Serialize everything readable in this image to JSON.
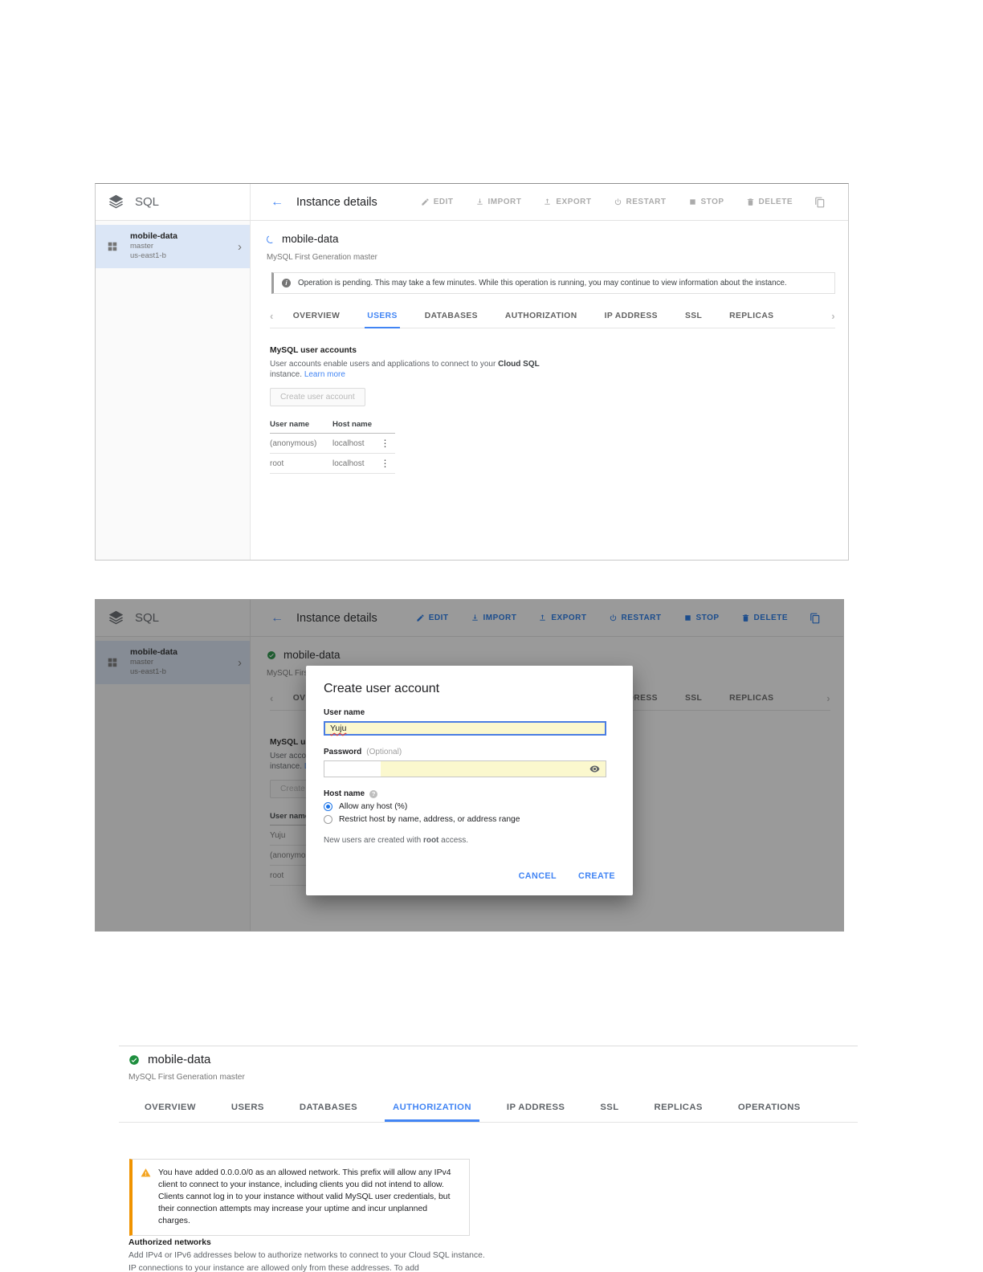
{
  "colors": {
    "accent_blue": "#4285f4",
    "toolbar_action_blue": "#1a73e8",
    "status_green": "#1e8e3e",
    "warning_orange": "#f09300",
    "autofill_yellow": "#fbf8ce",
    "selected_row_blue": "#dbe6f6"
  },
  "icons": {
    "back": "←",
    "overflow_menu": "⋮",
    "sidebar_chevron": "›",
    "tabs_prev": "‹",
    "tabs_next": "›",
    "info": "i",
    "help": "?"
  },
  "appbar": {
    "product": "SQL",
    "title": "Instance details",
    "actions": [
      "EDIT",
      "IMPORT",
      "EXPORT",
      "RESTART",
      "STOP",
      "DELETE"
    ]
  },
  "sidebar": {
    "instance_name": "mobile-data",
    "instance_role": "master",
    "instance_zone": "us-east1-b"
  },
  "instance": {
    "name": "mobile-data",
    "subtitle": "MySQL First Generation master"
  },
  "banner": {
    "text": "Operation is pending. This may take a few minutes. While this operation is running, you may continue to view information about the instance."
  },
  "tabs_main": [
    "OVERVIEW",
    "USERS",
    "DATABASES",
    "AUTHORIZATION",
    "IP ADDRESS",
    "SSL",
    "REPLICAS"
  ],
  "tabs_main_active": "USERS",
  "users_section": {
    "heading": "MySQL user accounts",
    "desc_pre": "User accounts enable users and applications to connect to your ",
    "desc_bold": "Cloud SQL",
    "desc_post": " instance. ",
    "learn_more": "Learn more",
    "create_button": "Create user account",
    "col_user": "User name",
    "col_host": "Host name",
    "rows_shot1": [
      {
        "user": "(anonymous)",
        "host": "localhost"
      },
      {
        "user": "root",
        "host": "localhost"
      }
    ],
    "rows_shot2": [
      {
        "user": "Yuju"
      },
      {
        "user": "(anonymous)"
      },
      {
        "user": "root"
      }
    ]
  },
  "dialog": {
    "title": "Create user account",
    "username_label": "User name",
    "username_value": "Yuju",
    "password_label": "Password",
    "password_hint": "(Optional)",
    "hostname_label": "Host name",
    "option_any_host": "Allow any host (%)",
    "option_restrict": "Restrict host by name, address, or address range",
    "note_pre": "New users are created with ",
    "note_bold": "root",
    "note_post": " access.",
    "cancel": "CANCEL",
    "create": "CREATE"
  },
  "shot3": {
    "instance_name": "mobile-data",
    "subtitle": "MySQL First Generation master",
    "tabs": [
      "OVERVIEW",
      "USERS",
      "DATABASES",
      "AUTHORIZATION",
      "IP ADDRESS",
      "SSL",
      "REPLICAS",
      "OPERATIONS"
    ],
    "active_tab": "AUTHORIZATION",
    "warning_text": "You have added 0.0.0.0/0 as an allowed network. This prefix will allow any IPv4 client to connect to your instance, including clients you did not intend to allow. Clients cannot log in to your instance without valid MySQL user credentials, but their connection attempts may increase your uptime and incur unplanned charges.",
    "authorized_heading": "Authorized networks",
    "authorized_desc": "Add IPv4 or IPv6 addresses below to authorize networks to connect to your Cloud SQL instance. IP connections to your instance are allowed only from these addresses. To add"
  }
}
